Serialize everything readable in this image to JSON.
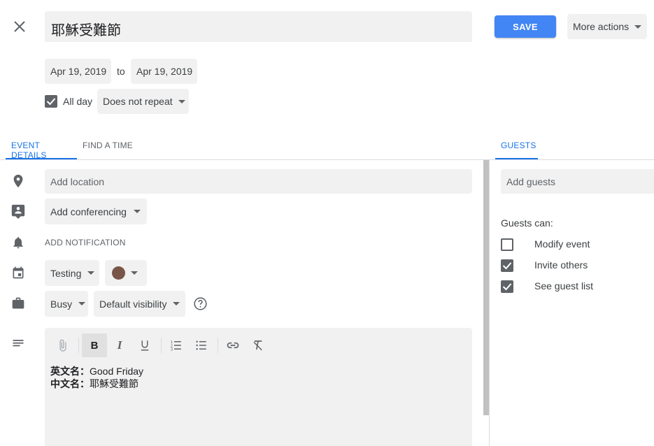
{
  "event": {
    "title": "耶穌受難節",
    "start_date": "Apr 19, 2019",
    "to_label": "to",
    "end_date": "Apr 19, 2019",
    "all_day_label": "All day",
    "all_day_checked": true,
    "repeat": "Does not repeat"
  },
  "header": {
    "save_label": "SAVE",
    "more_actions_label": "More actions"
  },
  "tabs": {
    "event_details": "EVENT DETAILS",
    "find_a_time": "FIND A TIME",
    "guests": "GUESTS"
  },
  "details": {
    "location_placeholder": "Add location",
    "conferencing": "Add conferencing",
    "add_notification": "ADD NOTIFICATION",
    "calendar": "Testing",
    "event_color": "#795548",
    "availability": "Busy",
    "visibility": "Default visibility"
  },
  "description": {
    "line1_label": "英文名：",
    "line1_value": "Good Friday",
    "line2_label": "中文名：",
    "line2_value": "耶穌受難節"
  },
  "guests": {
    "add_placeholder": "Add guests",
    "can_label": "Guests can:",
    "permissions": [
      {
        "label": "Modify event",
        "checked": false
      },
      {
        "label": "Invite others",
        "checked": true
      },
      {
        "label": "See guest list",
        "checked": true
      }
    ]
  },
  "colors": {
    "accent": "#4285f4",
    "tab_active": "#1a73e8",
    "field_bg": "#f1f1f1"
  }
}
